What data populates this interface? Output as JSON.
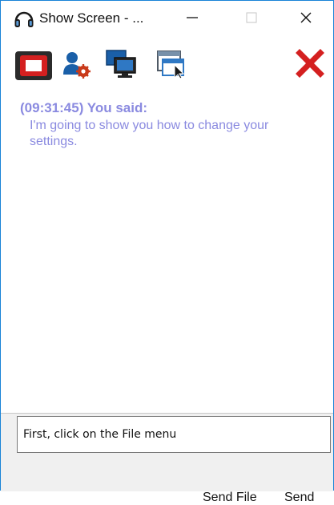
{
  "window": {
    "title": "Show Screen - ...",
    "app_icon": "headset-icon",
    "controls": {
      "minimize": "minimize-icon",
      "maximize": "maximize-icon",
      "close": "close-icon"
    }
  },
  "toolbar": {
    "items": [
      {
        "icon": "screen-share-icon",
        "active": true
      },
      {
        "icon": "user-settings-icon"
      },
      {
        "icon": "monitors-icon"
      },
      {
        "icon": "window-pointer-icon"
      },
      {
        "icon": "red-x-icon"
      }
    ]
  },
  "chat": {
    "messages": [
      {
        "header": "(09:31:45) You said:",
        "text": "I'm going to show you how to change your settings."
      }
    ],
    "text_color": "#8a8ae0"
  },
  "composer": {
    "value": "First, click on the File menu",
    "send_file_label": "Send File",
    "send_label": "Send"
  },
  "colors": {
    "accent": "#1883d7",
    "close_red": "#d42020",
    "active_border": "#d42020"
  }
}
